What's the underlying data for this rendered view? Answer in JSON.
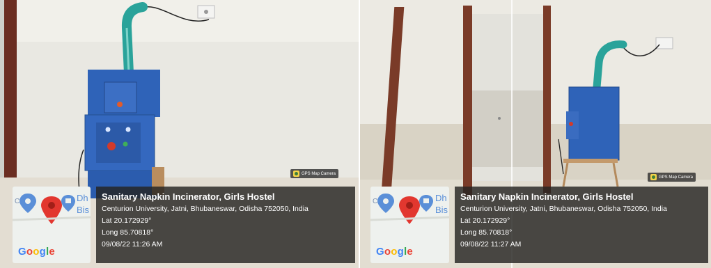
{
  "photos": [
    {
      "badge": "GPS Map Camera",
      "map": {
        "fragment_left": "C",
        "fragment_right_1": "Dh",
        "fragment_right_2": "Bis",
        "logo": "Google"
      },
      "title": "Sanitary Napkin Incinerator, Girls Hostel",
      "address": "Centurion University, Jatni, Bhubaneswar, Odisha 752050, India",
      "lat": "Lat 20.172929°",
      "long": "Long 85.70818°",
      "datetime": "09/08/22 11:26 AM"
    },
    {
      "badge": "GPS Map Camera",
      "map": {
        "fragment_left": "C",
        "fragment_right_1": "Dh",
        "fragment_right_2": "Bis",
        "logo": "Google"
      },
      "title": "Sanitary Napkin Incinerator, Girls Hostel",
      "address": "Centurion University, Jatni, Bhubaneswar, Odisha 752050, India",
      "lat": "Lat 20.172929°",
      "long": "Long 85.70818°",
      "datetime": "09/08/22 11:27 AM"
    }
  ],
  "colors": {
    "machine_blue": "#2f63b8",
    "hose_teal": "#2aa39a",
    "door_frame": "#7a3b28",
    "overlay": "#262422"
  }
}
